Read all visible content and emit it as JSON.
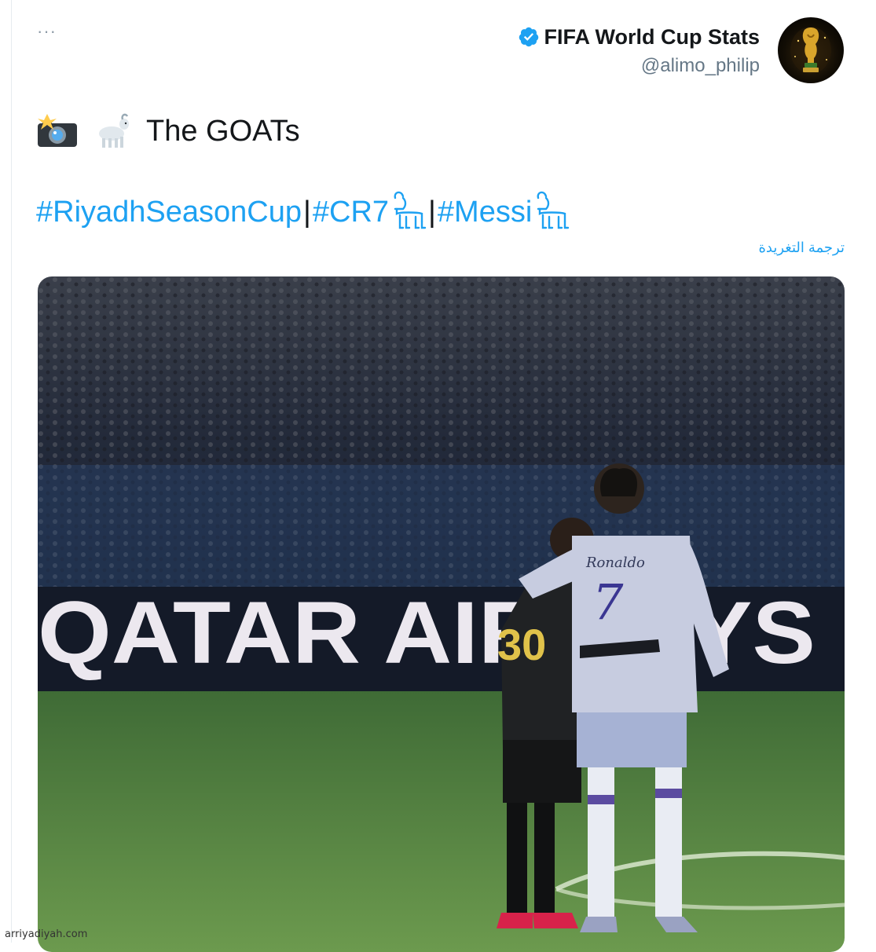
{
  "tweet": {
    "author": {
      "display_name": "FIFA World Cup Stats",
      "handle": "@alimo_philip",
      "verified": true,
      "avatar_icon": "world-cup-trophy-icon"
    },
    "more_label": "···",
    "text": "The GOATs",
    "emojis": [
      "camera-flash-icon",
      "goat-icon"
    ],
    "hashtags": [
      "#RiyadhSeasonCup",
      "#CR7",
      "#Messi"
    ],
    "separator": "|",
    "translate_label": "ترجمة التغريدة",
    "photo": {
      "banner_text": "QATAR AIRWAYS",
      "left_player_number": "30",
      "right_player_name": "Ronaldo",
      "right_player_number": "7"
    }
  },
  "watermark": "arriyadiyah.com",
  "colors": {
    "link": "#1da1f2",
    "text": "#14171a",
    "muted": "#657786",
    "verified": "#1da1f2"
  }
}
